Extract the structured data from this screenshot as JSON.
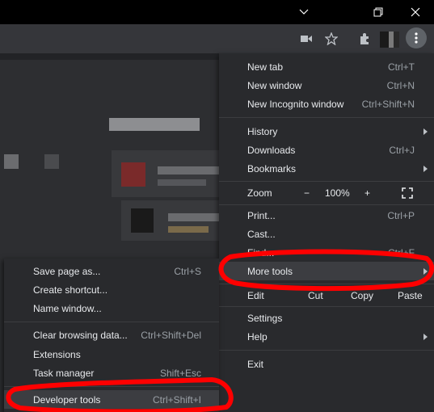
{
  "main_menu": {
    "new_tab": {
      "label": "New tab",
      "shortcut": "Ctrl+T"
    },
    "new_window": {
      "label": "New window",
      "shortcut": "Ctrl+N"
    },
    "new_incognito": {
      "label": "New Incognito window",
      "shortcut": "Ctrl+Shift+N"
    },
    "history": {
      "label": "History"
    },
    "downloads": {
      "label": "Downloads",
      "shortcut": "Ctrl+J"
    },
    "bookmarks": {
      "label": "Bookmarks"
    },
    "zoom": {
      "label": "Zoom",
      "minus": "−",
      "value": "100%",
      "plus": "+"
    },
    "print": {
      "label": "Print...",
      "shortcut": "Ctrl+P"
    },
    "cast": {
      "label": "Cast..."
    },
    "find": {
      "label": "Find...",
      "shortcut": "Ctrl+F"
    },
    "more_tools": {
      "label": "More tools"
    },
    "edit": {
      "label": "Edit",
      "cut": "Cut",
      "copy": "Copy",
      "paste": "Paste"
    },
    "settings": {
      "label": "Settings"
    },
    "help": {
      "label": "Help"
    },
    "exit": {
      "label": "Exit"
    }
  },
  "sub_menu": {
    "save_page": {
      "label": "Save page as...",
      "shortcut": "Ctrl+S"
    },
    "create_shortcut": {
      "label": "Create shortcut..."
    },
    "name_window": {
      "label": "Name window..."
    },
    "clear_browsing": {
      "label": "Clear browsing data...",
      "shortcut": "Ctrl+Shift+Del"
    },
    "extensions": {
      "label": "Extensions"
    },
    "task_manager": {
      "label": "Task manager",
      "shortcut": "Shift+Esc"
    },
    "developer_tools": {
      "label": "Developer tools",
      "shortcut": "Ctrl+Shift+I"
    }
  },
  "colors": {
    "annotation": "#ff0000",
    "menu_bg": "#292a2d",
    "highlight": "#3c3d41"
  }
}
